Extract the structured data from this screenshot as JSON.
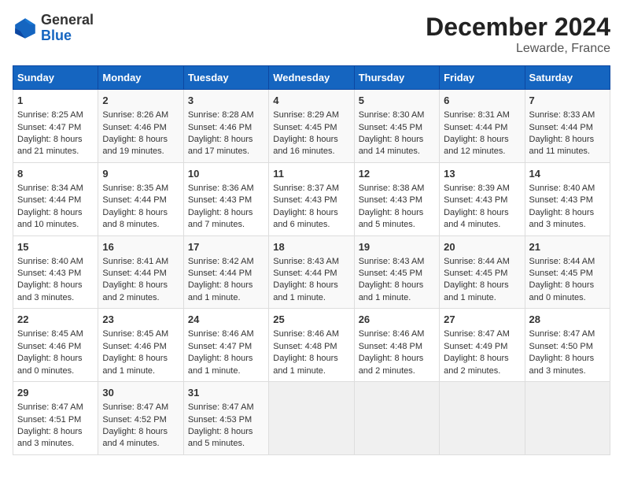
{
  "logo": {
    "line1": "General",
    "line2": "Blue"
  },
  "title": "December 2024",
  "subtitle": "Lewarde, France",
  "days_of_week": [
    "Sunday",
    "Monday",
    "Tuesday",
    "Wednesday",
    "Thursday",
    "Friday",
    "Saturday"
  ],
  "weeks": [
    [
      {
        "day": 1,
        "sunrise": "8:25 AM",
        "sunset": "4:47 PM",
        "daylight": "8 hours and 21 minutes."
      },
      {
        "day": 2,
        "sunrise": "8:26 AM",
        "sunset": "4:46 PM",
        "daylight": "8 hours and 19 minutes."
      },
      {
        "day": 3,
        "sunrise": "8:28 AM",
        "sunset": "4:46 PM",
        "daylight": "8 hours and 17 minutes."
      },
      {
        "day": 4,
        "sunrise": "8:29 AM",
        "sunset": "4:45 PM",
        "daylight": "8 hours and 16 minutes."
      },
      {
        "day": 5,
        "sunrise": "8:30 AM",
        "sunset": "4:45 PM",
        "daylight": "8 hours and 14 minutes."
      },
      {
        "day": 6,
        "sunrise": "8:31 AM",
        "sunset": "4:44 PM",
        "daylight": "8 hours and 12 minutes."
      },
      {
        "day": 7,
        "sunrise": "8:33 AM",
        "sunset": "4:44 PM",
        "daylight": "8 hours and 11 minutes."
      }
    ],
    [
      {
        "day": 8,
        "sunrise": "8:34 AM",
        "sunset": "4:44 PM",
        "daylight": "8 hours and 10 minutes."
      },
      {
        "day": 9,
        "sunrise": "8:35 AM",
        "sunset": "4:44 PM",
        "daylight": "8 hours and 8 minutes."
      },
      {
        "day": 10,
        "sunrise": "8:36 AM",
        "sunset": "4:43 PM",
        "daylight": "8 hours and 7 minutes."
      },
      {
        "day": 11,
        "sunrise": "8:37 AM",
        "sunset": "4:43 PM",
        "daylight": "8 hours and 6 minutes."
      },
      {
        "day": 12,
        "sunrise": "8:38 AM",
        "sunset": "4:43 PM",
        "daylight": "8 hours and 5 minutes."
      },
      {
        "day": 13,
        "sunrise": "8:39 AM",
        "sunset": "4:43 PM",
        "daylight": "8 hours and 4 minutes."
      },
      {
        "day": 14,
        "sunrise": "8:40 AM",
        "sunset": "4:43 PM",
        "daylight": "8 hours and 3 minutes."
      }
    ],
    [
      {
        "day": 15,
        "sunrise": "8:40 AM",
        "sunset": "4:43 PM",
        "daylight": "8 hours and 3 minutes."
      },
      {
        "day": 16,
        "sunrise": "8:41 AM",
        "sunset": "4:44 PM",
        "daylight": "8 hours and 2 minutes."
      },
      {
        "day": 17,
        "sunrise": "8:42 AM",
        "sunset": "4:44 PM",
        "daylight": "8 hours and 1 minute."
      },
      {
        "day": 18,
        "sunrise": "8:43 AM",
        "sunset": "4:44 PM",
        "daylight": "8 hours and 1 minute."
      },
      {
        "day": 19,
        "sunrise": "8:43 AM",
        "sunset": "4:45 PM",
        "daylight": "8 hours and 1 minute."
      },
      {
        "day": 20,
        "sunrise": "8:44 AM",
        "sunset": "4:45 PM",
        "daylight": "8 hours and 1 minute."
      },
      {
        "day": 21,
        "sunrise": "8:44 AM",
        "sunset": "4:45 PM",
        "daylight": "8 hours and 0 minutes."
      }
    ],
    [
      {
        "day": 22,
        "sunrise": "8:45 AM",
        "sunset": "4:46 PM",
        "daylight": "8 hours and 0 minutes."
      },
      {
        "day": 23,
        "sunrise": "8:45 AM",
        "sunset": "4:46 PM",
        "daylight": "8 hours and 1 minute."
      },
      {
        "day": 24,
        "sunrise": "8:46 AM",
        "sunset": "4:47 PM",
        "daylight": "8 hours and 1 minute."
      },
      {
        "day": 25,
        "sunrise": "8:46 AM",
        "sunset": "4:48 PM",
        "daylight": "8 hours and 1 minute."
      },
      {
        "day": 26,
        "sunrise": "8:46 AM",
        "sunset": "4:48 PM",
        "daylight": "8 hours and 2 minutes."
      },
      {
        "day": 27,
        "sunrise": "8:47 AM",
        "sunset": "4:49 PM",
        "daylight": "8 hours and 2 minutes."
      },
      {
        "day": 28,
        "sunrise": "8:47 AM",
        "sunset": "4:50 PM",
        "daylight": "8 hours and 3 minutes."
      }
    ],
    [
      {
        "day": 29,
        "sunrise": "8:47 AM",
        "sunset": "4:51 PM",
        "daylight": "8 hours and 3 minutes."
      },
      {
        "day": 30,
        "sunrise": "8:47 AM",
        "sunset": "4:52 PM",
        "daylight": "8 hours and 4 minutes."
      },
      {
        "day": 31,
        "sunrise": "8:47 AM",
        "sunset": "4:53 PM",
        "daylight": "8 hours and 5 minutes."
      },
      null,
      null,
      null,
      null
    ]
  ]
}
